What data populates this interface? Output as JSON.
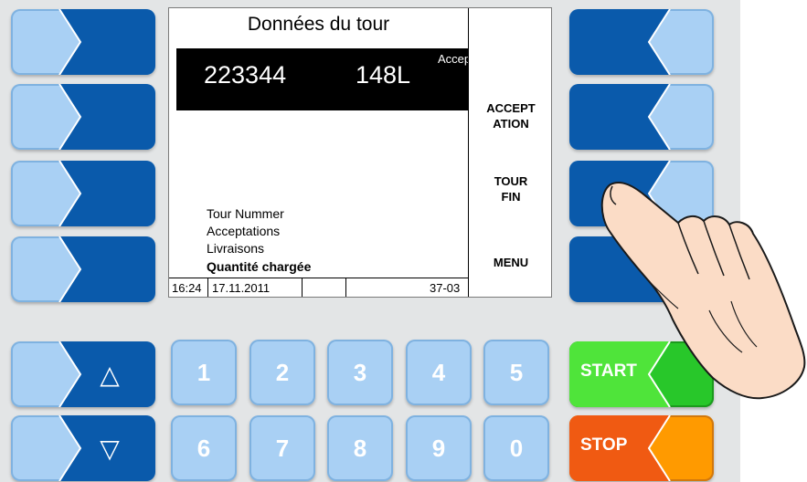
{
  "screen": {
    "title": "Données du tour",
    "highlight": {
      "tour_number": "223344",
      "quantity": "148L",
      "status_truncated": "Accept"
    },
    "labels": [
      "Tour Nummer",
      "Acceptations",
      "Livraisons",
      "Quantité chargée"
    ],
    "softkeys": {
      "accept": [
        "ACCEPT",
        "ATION"
      ],
      "tour_end": [
        "TOUR",
        "FIN"
      ],
      "menu": "MENU"
    },
    "status_bar": {
      "time": "16:24",
      "date": "17.11.2011",
      "code": "37-03"
    }
  },
  "keypad": {
    "row1": [
      "1",
      "2",
      "3",
      "4",
      "5"
    ],
    "row2": [
      "6",
      "7",
      "8",
      "9",
      "0"
    ]
  },
  "nav": {
    "up_icon": "△",
    "down_icon": "▽"
  },
  "control": {
    "start": "START",
    "stop": "STOP"
  },
  "colors": {
    "key_light": "#a9d0f4",
    "key_dark": "#0a5aab",
    "start": "#28c72a",
    "stop": "#f07312",
    "panel": "#e3e5e6"
  }
}
